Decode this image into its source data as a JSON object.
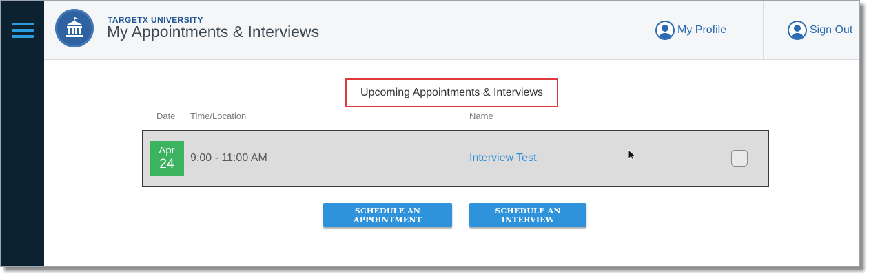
{
  "header": {
    "brand": "TARGETX UNIVERSITY",
    "title": "My Appointments & Interviews",
    "profile_label": "My Profile",
    "signout_label": "Sign Out"
  },
  "main": {
    "section_title": "Upcoming Appointments & Interviews",
    "columns": {
      "date": "Date",
      "time_location": "Time/Location",
      "name": "Name"
    },
    "appointments": [
      {
        "month": "Apr",
        "day": "24",
        "time": "9:00 - 11:00 AM",
        "name": "Interview Test",
        "selected": false
      }
    ],
    "buttons": {
      "schedule_appointment": "SCHEDULE AN APPOINTMENT",
      "schedule_interview": "SCHEDULE AN INTERVIEW"
    }
  },
  "colors": {
    "sidebar": "#0c2231",
    "accent": "#2e93da",
    "date_badge": "#3cb35f",
    "highlight_border": "#e0393e"
  }
}
